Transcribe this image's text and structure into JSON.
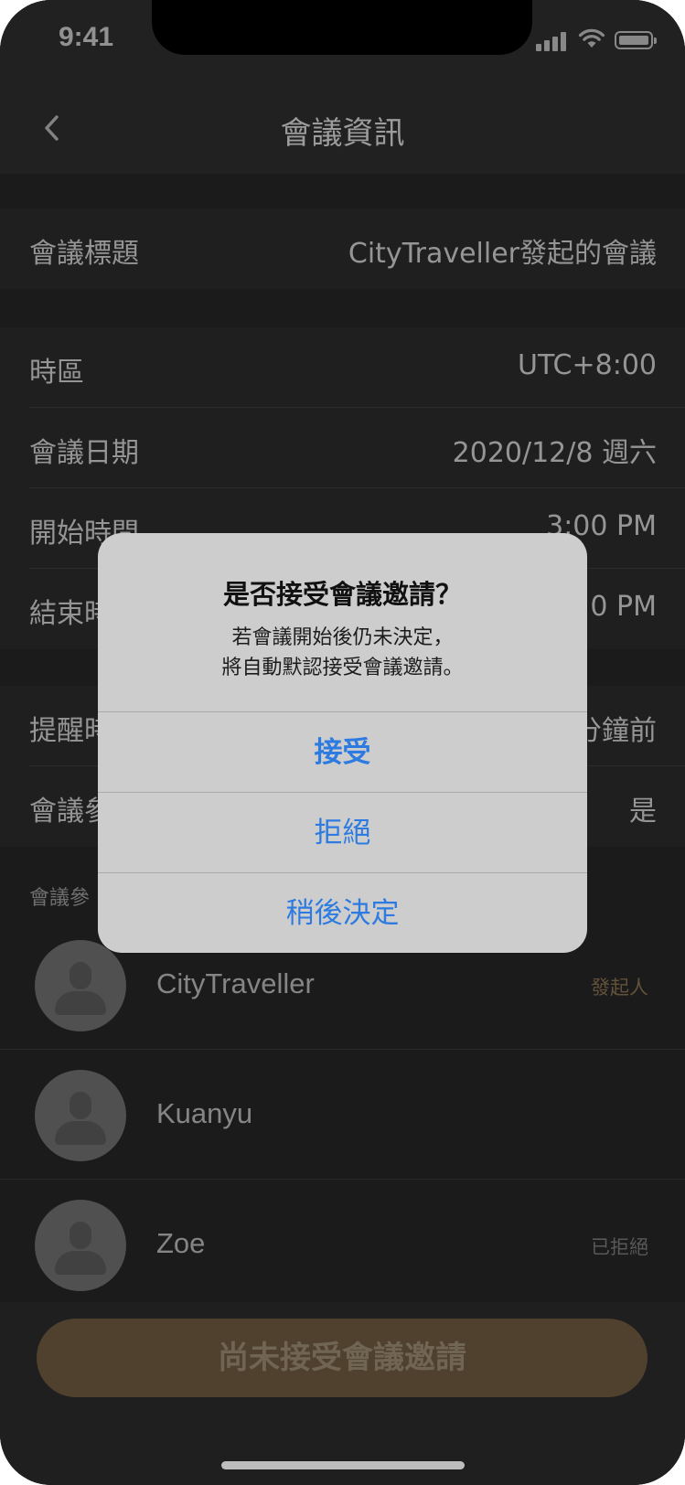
{
  "status_bar": {
    "time": "9:41"
  },
  "nav": {
    "title": "會議資訊"
  },
  "meeting_title_row": {
    "label": "會議標題",
    "value": "CityTraveller發起的會議"
  },
  "time_rows": [
    {
      "label": "時區",
      "value": "UTC+8:00"
    },
    {
      "label": "會議日期",
      "value": "2020/12/8 週六"
    },
    {
      "label": "開始時間",
      "value": "3:00 PM"
    },
    {
      "label": "結束時",
      "value": "0 PM"
    }
  ],
  "reminder_rows": [
    {
      "label": "提醒時",
      "value": "分鐘前"
    },
    {
      "label": "會議參",
      "value": "是"
    }
  ],
  "participants_header": "會議參",
  "participants": [
    {
      "name": "CityTraveller",
      "tag": "發起人",
      "tag_color": "#8a7250"
    },
    {
      "name": "Kuanyu",
      "tag": "",
      "tag_color": "#7a7a7a"
    },
    {
      "name": "Zoe",
      "tag": "已拒絕",
      "tag_color": "#7a7a7a"
    }
  ],
  "bottom": {
    "button_label": "尚未接受會議邀請"
  },
  "alert": {
    "title": "是否接受會議邀請？",
    "message_line1": "若會議開始後仍未決定，",
    "message_line2": "將自動默認接受會議邀請。",
    "buttons": {
      "accept": "接受",
      "decline": "拒絕",
      "later": "稍後決定"
    }
  },
  "colors": {
    "accent_blue": "#2d7be0",
    "cta_gold": "#6e5a40"
  }
}
